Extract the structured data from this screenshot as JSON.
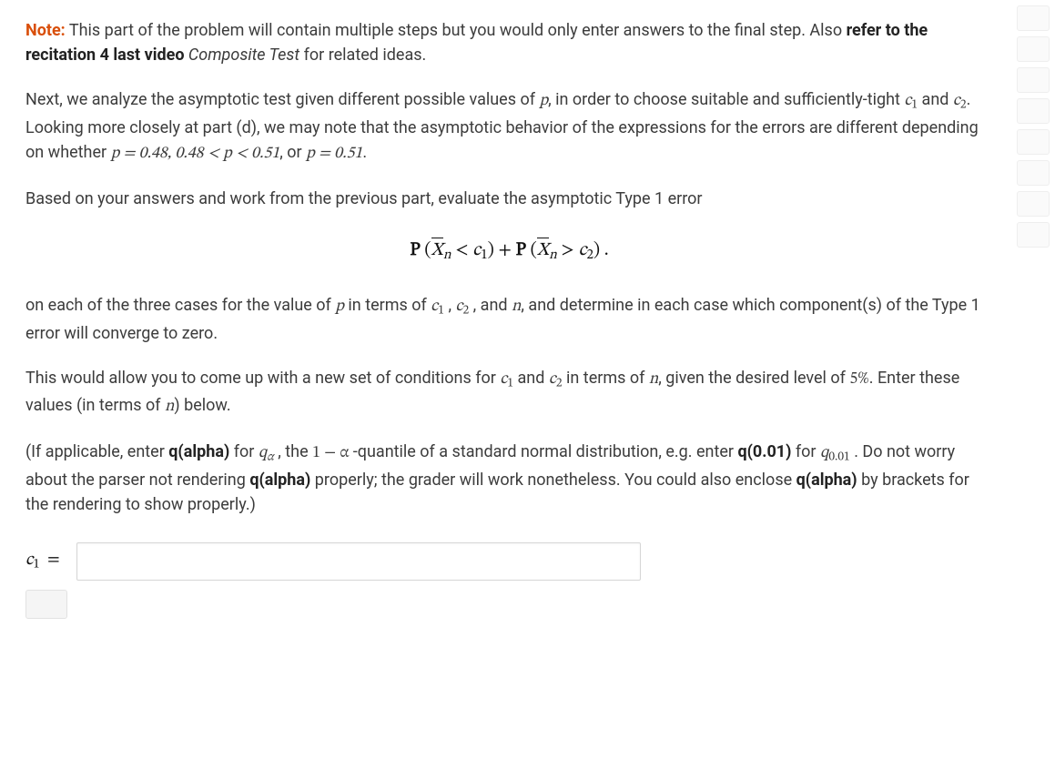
{
  "note": {
    "label": "Note:",
    "body_a": " This part of the problem will contain multiple steps but you would only enter answers to the final step. Also ",
    "bold_ref": "refer to the recitation 4 last video",
    "ital_ref": " Composite Test",
    "body_b": " for related ideas."
  },
  "para2": {
    "a": "Next, we analyze the asymptotic test given different possible values of ",
    "p": "p",
    "b": ", in order to choose suitable and sufficiently-tight ",
    "c1": "c",
    "c1sub": "1",
    "and1": " and ",
    "c2": "c",
    "c2sub": "2",
    "c": ". Looking more closely at part (d), we may note that the asymptotic behavior of the expressions for the errors are different depending on whether ",
    "rng": "p = 0.48, 0.48 < p < 0.51",
    "or": ", or ",
    "rng2": "p = 0.51",
    "end": "."
  },
  "para3": "Based on your answers and work from the previous part, evaluate the asymptotic Type 1 error",
  "formula": {
    "P1": "P",
    "lp1": " (",
    "X1": "X",
    "n1": "n",
    "lt": " < ",
    "c1": "c",
    "c1s": "1",
    "rp1": ") ",
    "plus": "+ ",
    "P2": "P",
    "lp2": " (",
    "X2": "X",
    "n2": "n",
    "gt": " > ",
    "c2": "c",
    "c2s": "2",
    "rp2": ") ."
  },
  "para4": {
    "a": "on each of the three cases for the value of ",
    "p": "p",
    "b": " in terms of ",
    "c1": "c",
    "c1s": "1",
    "sep1": " , ",
    "c2": "c",
    "c2s": "2",
    "sep2": " , and ",
    "n": "n",
    "c": ", and determine in each case which component(s) of the Type 1 error will converge to zero."
  },
  "para5": {
    "a": "This would allow you to come up with a new set of conditions for ",
    "c1": "c",
    "c1s": "1",
    "and": " and ",
    "c2": "c",
    "c2s": "2",
    "b": " in terms of ",
    "n": "n",
    "c": ", given the desired level of ",
    "pct": "5%",
    "d": ". Enter these values (in terms of ",
    "n2": "n",
    "e": ") below."
  },
  "para6": {
    "a": "(If applicable, enter ",
    "qalpha": "q(alpha)",
    "b": " for ",
    "qa": "q",
    "qasub": "α",
    "c": " , the ",
    "oneminus": " 1 − α ",
    "d": "-quantile of a standard normal distribution, e.g. enter ",
    "q001": "q(0.01)",
    "e": " for ",
    "q001m": "q",
    "q001msub": "0.01",
    "f": " . Do not worry about the parser not rendering ",
    "qalpha2": "q(alpha)",
    "g": " properly; the grader will work nonetheless. You could also enclose ",
    "qalpha3": "q(alpha)",
    "h": " by brackets for the rendering to show properly.)"
  },
  "answer": {
    "label_c": "c",
    "label_sub": "1",
    "label_eq": "="
  }
}
